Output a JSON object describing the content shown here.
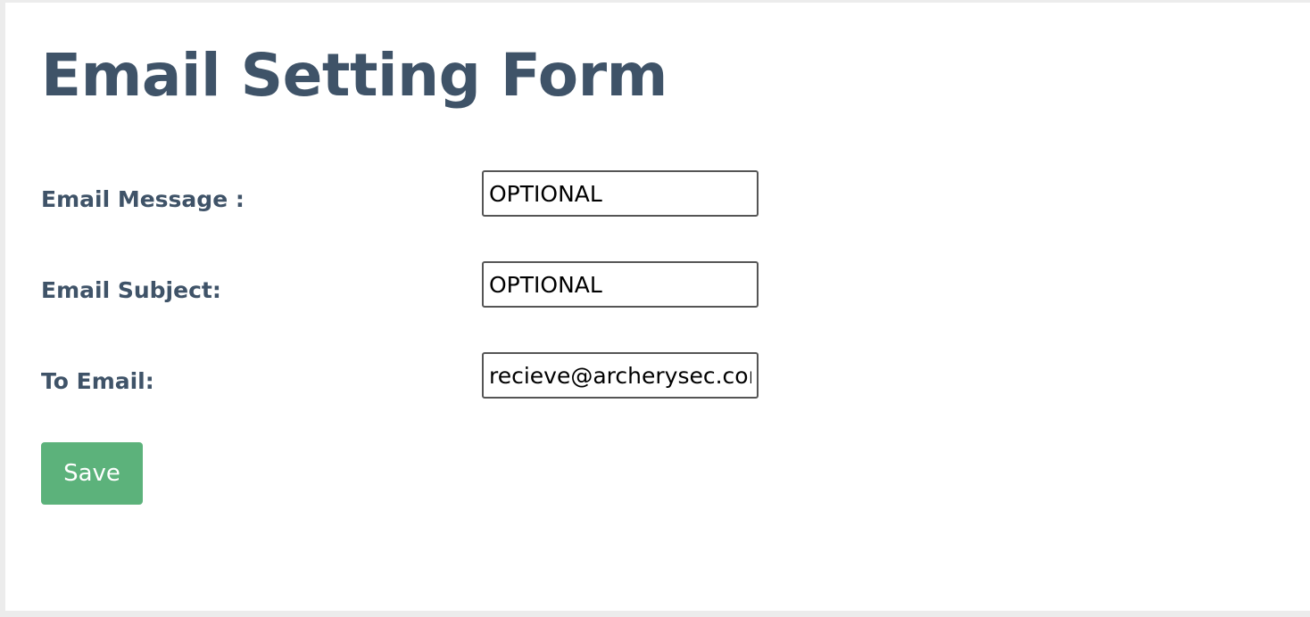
{
  "page": {
    "title": "Email Setting Form"
  },
  "form": {
    "fields": [
      {
        "label": "Email Message :",
        "value": "OPTIONAL"
      },
      {
        "label": "Email Subject:",
        "value": "OPTIONAL"
      },
      {
        "label": "To Email:",
        "value": "recieve@archerysec.com"
      }
    ],
    "save_label": "Save"
  },
  "colors": {
    "text": "#3f5368",
    "button": "#5cb27b",
    "background": "#ffffff",
    "frame": "#ececec"
  }
}
